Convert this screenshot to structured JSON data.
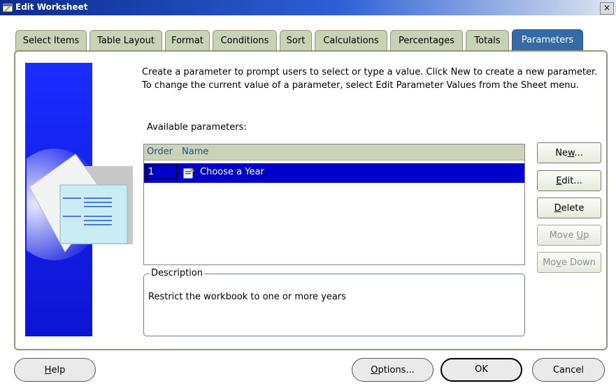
{
  "window": {
    "title": "Edit Worksheet",
    "close_glyph": "×"
  },
  "tabs": [
    {
      "label": "Select Items"
    },
    {
      "label": "Table Layout"
    },
    {
      "label": "Format"
    },
    {
      "label": "Conditions"
    },
    {
      "label": "Sort"
    },
    {
      "label": "Calculations"
    },
    {
      "label": "Percentages"
    },
    {
      "label": "Totals"
    },
    {
      "label": "Parameters",
      "active": true
    }
  ],
  "main": {
    "instructions": "Create a parameter to prompt users to select or type a value. Click New to create a new parameter. To change the current value of a parameter, select Edit Parameter Values from the Sheet menu.",
    "available_label": "Available parameters:",
    "table": {
      "columns": [
        "Order",
        "Name"
      ],
      "rows": [
        {
          "order": "1",
          "name": "Choose a Year",
          "icon": "parameter-icon",
          "selected": true
        }
      ]
    },
    "description_legend": "Description",
    "description_text": "Restrict the workbook to one or more years"
  },
  "side_buttons": {
    "new": {
      "pre": "Ne",
      "u": "w",
      "post": "..."
    },
    "edit": {
      "pre": "",
      "u": "E",
      "post": "dit..."
    },
    "delete": {
      "pre": "",
      "u": "D",
      "post": "elete"
    },
    "move_up": {
      "pre": "Move ",
      "u": "U",
      "post": "p"
    },
    "move_down": {
      "pre": "Mo",
      "u": "v",
      "post": "e Down"
    }
  },
  "bottom_buttons": {
    "help": {
      "pre": "",
      "u": "H",
      "post": "elp"
    },
    "options": {
      "pre": "",
      "u": "O",
      "post": "ptions..."
    },
    "ok": {
      "label": "OK"
    },
    "cancel": {
      "label": "Cancel"
    }
  },
  "colors": {
    "accent": "#356aa8",
    "selection": "#0000cc",
    "sidebar": "#1a2cff",
    "tab": "#c8d2b4"
  }
}
